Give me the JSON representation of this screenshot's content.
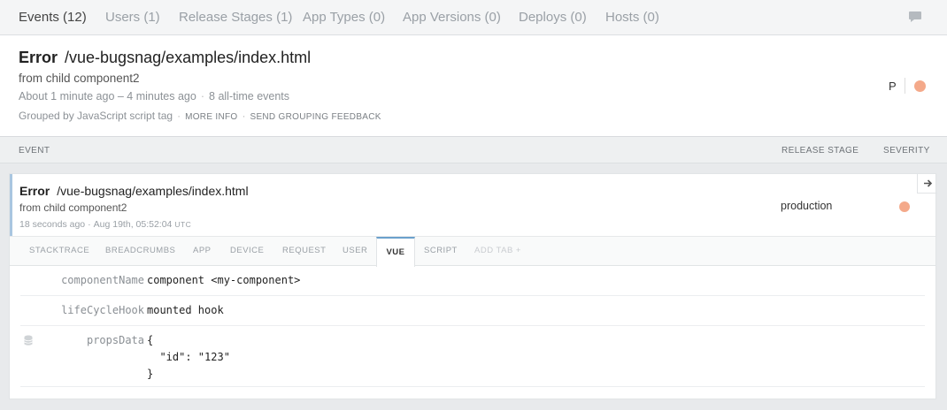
{
  "nav": {
    "tabs": [
      {
        "label": "Events (12)"
      },
      {
        "label": "Users (1)"
      },
      {
        "label": "Release Stages (1)"
      },
      {
        "label": "App Types (0)"
      },
      {
        "label": "App Versions (0)"
      },
      {
        "label": "Deploys (0)"
      },
      {
        "label": "Hosts (0)"
      }
    ],
    "active_tab": "Events (12)",
    "feedback_icon": "chat-bubble-icon"
  },
  "error": {
    "class": "Error",
    "location": "/vue-bugsnag/examples/index.html",
    "message": "from child component2",
    "time_range": "About 1 minute ago – 4 minutes ago",
    "event_count": "8 all-time events",
    "grouping": "Grouped by JavaScript script tag",
    "more_info": "MORE INFO",
    "feedback": "SEND GROUPING FEEDBACK",
    "user_initial": "P",
    "severity_color": "#f4a98a"
  },
  "columns": {
    "event": "EVENT",
    "release_stage": "RELEASE STAGE",
    "severity": "SEVERITY"
  },
  "event": {
    "class": "Error",
    "location": "/vue-bugsnag/examples/index.html",
    "message": "from child component2",
    "relative_time": "18 seconds ago",
    "timestamp": "Aug 19th, 05:52:04",
    "tz": "UTC",
    "release_stage": "production",
    "severity_color": "#f4a98a",
    "open_icon": "arrow-right-icon",
    "tabs": [
      {
        "label": "STACKTRACE"
      },
      {
        "label": "BREADCRUMBS"
      },
      {
        "label": "APP"
      },
      {
        "label": "DEVICE"
      },
      {
        "label": "REQUEST"
      },
      {
        "label": "USER"
      },
      {
        "label": "VUE"
      },
      {
        "label": "SCRIPT"
      },
      {
        "label": "ADD TAB +"
      }
    ],
    "active_tab": "VUE",
    "vue": {
      "componentName": {
        "key": "componentName",
        "value": "component <my-component>"
      },
      "lifeCycleHook": {
        "key": "lifeCycleHook",
        "value": "mounted hook"
      },
      "propsData": {
        "key": "propsData",
        "value": "{\n  \"id\": \"123\"\n}",
        "icon": "database-icon"
      }
    }
  }
}
